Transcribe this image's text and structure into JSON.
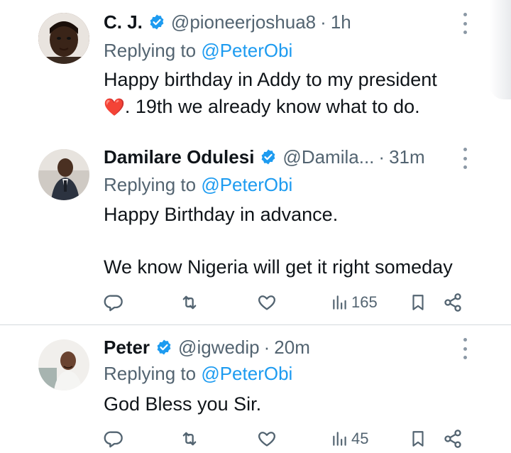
{
  "tweets": [
    {
      "name": "C. J.",
      "handle": "@pioneerjoshua8",
      "sep": "·",
      "time": "1h",
      "replying_prefix": "Replying to ",
      "replying_to": "@PeterObi",
      "lines": [
        "Happy birthday in Addy to my president",
        ". 19th  we already know what to do."
      ],
      "emoji": "❤️"
    },
    {
      "name": "Damilare Odulesi",
      "handle": "@Damila...",
      "sep": "·",
      "time": "31m",
      "replying_prefix": "Replying to ",
      "replying_to": "@PeterObi",
      "lines": [
        "Happy Birthday in advance.",
        "We know Nigeria will get it right someday"
      ],
      "views": "165"
    },
    {
      "name": "Peter",
      "handle": "@igwedip",
      "sep": "·",
      "time": "20m",
      "replying_prefix": "Replying to ",
      "replying_to": "@PeterObi",
      "lines": [
        "God Bless you Sir."
      ],
      "views": "45"
    }
  ],
  "colors": {
    "verified": "#1d9bf0",
    "link": "#1d9bf0",
    "muted": "#536471",
    "heart": "#e0245e"
  },
  "icons": [
    "verified-badge-icon",
    "more-icon",
    "reply-icon",
    "retweet-icon",
    "like-icon",
    "views-icon",
    "bookmark-icon",
    "share-icon"
  ]
}
